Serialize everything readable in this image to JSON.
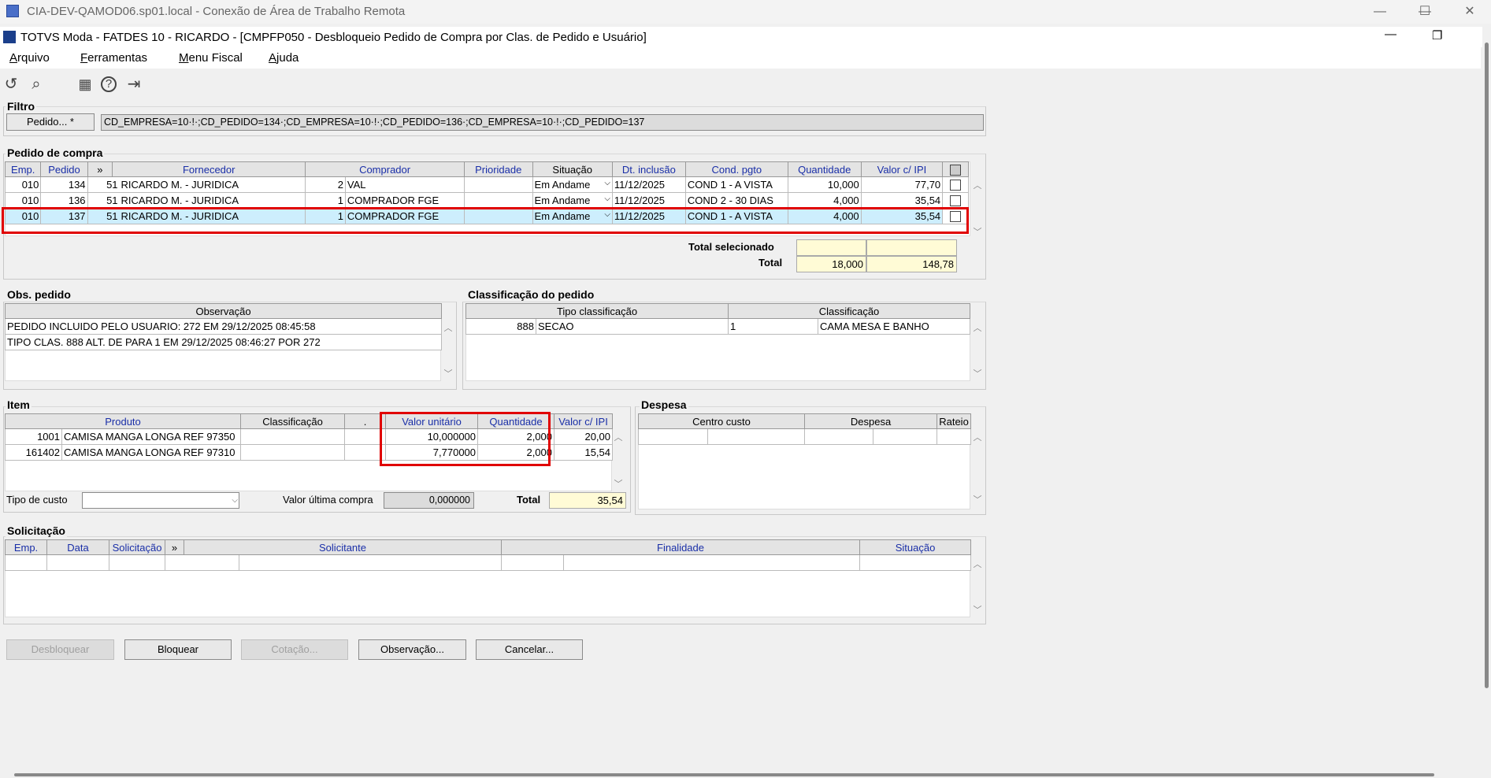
{
  "rdp": {
    "title": "CIA-DEV-QAMOD06.sp01.local - Conexão de Área de Trabalho Remota",
    "min": "—",
    "max": "☐",
    "close": "✕"
  },
  "app": {
    "title": "TOTVS Moda - FATDES 10 - RICARDO - [CMPFP050 - Desbloqueio Pedido de Compra por Clas. de Pedido e Usuário]",
    "min": "—",
    "restore": "❐"
  },
  "menu": {
    "items": [
      "Arquivo",
      "Ferramentas",
      "Menu Fiscal",
      "Ajuda"
    ]
  },
  "toolbar": {
    "icons": [
      "undo-icon",
      "search-icon",
      "calendar-icon",
      "help-icon",
      "exit-icon"
    ],
    "glyphs": [
      "↺",
      "⌕",
      "▦",
      "?",
      "⇥"
    ]
  },
  "filtro": {
    "label": "Filtro",
    "button": "Pedido... *",
    "value": "CD_EMPRESA=10·!·;CD_PEDIDO=134·;CD_EMPRESA=10·!·;CD_PEDIDO=136·;CD_EMPRESA=10·!·;CD_PEDIDO=137"
  },
  "pedido": {
    "label": "Pedido de compra",
    "columns": [
      "Emp.",
      "Pedido",
      "»",
      "Fornecedor",
      "Comprador",
      "Prioridade",
      "Situação",
      "Dt. inclusão",
      "Cond. pgto",
      "Quantidade",
      "Valor c/ IPI"
    ],
    "rows": [
      {
        "emp": "010",
        "pedido": "134",
        "cod": "51",
        "fornecedor": "RICARDO M. - JURIDICA",
        "comp_cod": "2",
        "comprador": "VAL",
        "prioridade": "",
        "situacao": "Em Andame",
        "dt": "11/12/2025",
        "cond": "COND 1 - A VISTA",
        "qtd": "10,000",
        "valor": "77,70"
      },
      {
        "emp": "010",
        "pedido": "136",
        "cod": "51",
        "fornecedor": "RICARDO M. - JURIDICA",
        "comp_cod": "1",
        "comprador": "COMPRADOR FGE",
        "prioridade": "",
        "situacao": "Em Andame",
        "dt": "11/12/2025",
        "cond": "COND 2 - 30 DIAS",
        "qtd": "4,000",
        "valor": "35,54"
      },
      {
        "emp": "010",
        "pedido": "137",
        "cod": "51",
        "fornecedor": "RICARDO M. - JURIDICA",
        "comp_cod": "1",
        "comprador": "COMPRADOR FGE",
        "prioridade": "",
        "situacao": "Em Andame",
        "dt": "11/12/2025",
        "cond": "COND 1 - A VISTA",
        "qtd": "4,000",
        "valor": "35,54"
      }
    ],
    "total_sel_label": "Total selecionado",
    "total_label": "Total",
    "total_sel_qtd": "",
    "total_sel_valor": "",
    "total_qtd": "18,000",
    "total_valor": "148,78"
  },
  "obs": {
    "label": "Obs. pedido",
    "column": "Observação",
    "rows": [
      "PEDIDO INCLUIDO PELO USUARIO: 272 EM 29/12/2025 08:45:58",
      "TIPO CLAS. 888 ALT. DE  PARA 1 EM 29/12/2025 08:46:27 POR 272"
    ]
  },
  "classif": {
    "label": "Classificação do pedido",
    "columns": [
      "Tipo classificação",
      "Classificação"
    ],
    "rows": [
      {
        "cod": "888",
        "tipo": "SECAO",
        "ccod": "1",
        "class": "CAMA MESA E BANHO"
      }
    ]
  },
  "item": {
    "label": "Item",
    "columns": [
      "Produto",
      "Classificação",
      ".",
      "Valor unitário",
      "Quantidade",
      "Valor c/ IPI"
    ],
    "rows": [
      {
        "cod": "1001",
        "produto": "CAMISA MANGA LONGA REF 97350",
        "vu": "10,000000",
        "qtd": "2,000",
        "valor": "20,00"
      },
      {
        "cod": "161402",
        "produto": "CAMISA MANGA LONGA REF 97310",
        "vu": "7,770000",
        "qtd": "2,000",
        "valor": "15,54"
      }
    ],
    "tipo_custo_label": "Tipo de custo",
    "tipo_custo_value": "",
    "ultima_label": "Valor última compra",
    "ultima_value": "0,000000",
    "total_label": "Total",
    "total_value": "35,54"
  },
  "despesa": {
    "label": "Despesa",
    "columns": [
      "Centro custo",
      "Despesa",
      "Rateio"
    ]
  },
  "solic": {
    "label": "Solicitação",
    "columns": [
      "Emp.",
      "Data",
      "Solicitação",
      "»",
      "Solicitante",
      "Finalidade",
      "Situação"
    ]
  },
  "buttons": {
    "desbloquear": "Desbloquear",
    "bloquear": "Bloquear",
    "cotacao": "Cotação...",
    "observacao": "Observação...",
    "cancelar": "Cancelar..."
  },
  "colors": {
    "highlight": "#e00000",
    "selected_row": "#cdeefd",
    "header_text": "#1a2fa8",
    "total_bg": "#fffbd6"
  }
}
